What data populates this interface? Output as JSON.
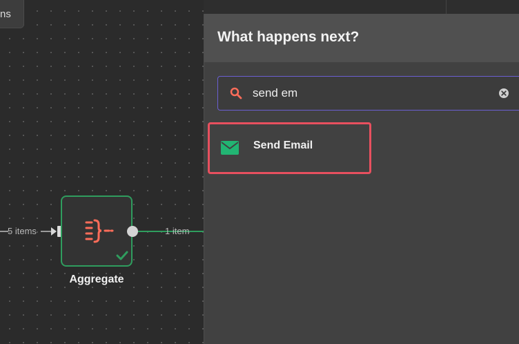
{
  "colors": {
    "accent_purple": "#6b5fd3",
    "success_green": "#2f9d5e",
    "node_orange": "#ff6d5a",
    "highlight_red": "#e8505f",
    "email_green": "#22b573"
  },
  "toolbar": {
    "tab_label": "ns"
  },
  "canvas": {
    "incoming_label": "5 items",
    "node": {
      "label": "Aggregate",
      "icon": "aggregate-icon",
      "status_icon": "check-icon"
    },
    "outgoing_label": "1 item"
  },
  "panel": {
    "title": "What happens next?",
    "search": {
      "value": "send em",
      "icon": "search-icon",
      "clear_icon": "clear-icon"
    },
    "results": [
      {
        "label": "Send Email",
        "icon": "envelope-icon"
      }
    ]
  }
}
